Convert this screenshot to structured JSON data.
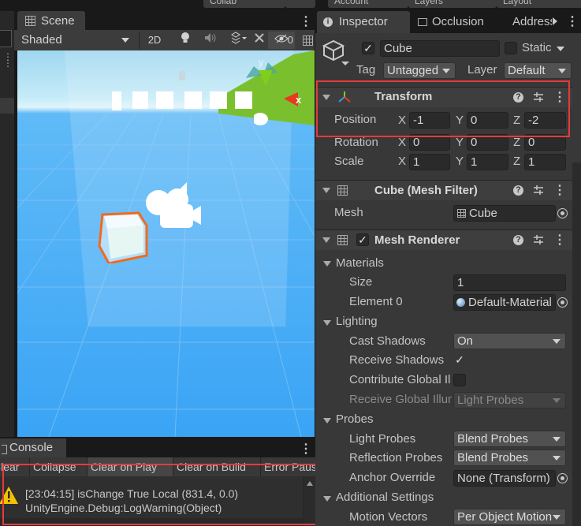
{
  "top": {
    "buttons": [
      "Collab",
      "Account",
      "Layers",
      "Layout"
    ]
  },
  "scene": {
    "tab_label": "Scene",
    "shading_mode": "Shaded",
    "toggle_2d": "2D",
    "gizmo_x_label": "x",
    "gizmo_y_label": "y",
    "hidden_count": "0"
  },
  "console": {
    "tab_label": "Console",
    "toolbar": [
      "Clear",
      "Collapse",
      "Clear on Play",
      "Clear on Build",
      "Error Pause"
    ],
    "log_line1": "[23:04:15] isChange   True   Local   (831.4, 0.0)",
    "log_line2": "UnityEngine.Debug:LogWarning(Object)"
  },
  "inspector": {
    "tabs": [
      "Inspector",
      "Occlusion",
      "Addressables"
    ],
    "object_name": "Cube",
    "static_label": "Static",
    "tag_label": "Tag",
    "tag_value": "Untagged",
    "layer_label": "Layer",
    "layer_value": "Default",
    "transform": {
      "title": "Transform",
      "position_label": "Position",
      "rotation_label": "Rotation",
      "scale_label": "Scale",
      "axes": [
        "X",
        "Y",
        "Z"
      ],
      "position": [
        "-1",
        "0",
        "-2"
      ],
      "rotation": [
        "0",
        "0",
        "0"
      ],
      "scale": [
        "1",
        "1",
        "1"
      ]
    },
    "mesh_filter": {
      "title": "Cube (Mesh Filter)",
      "mesh_label": "Mesh",
      "mesh_value": "Cube"
    },
    "mesh_renderer": {
      "title": "Mesh Renderer",
      "materials_label": "Materials",
      "size_label": "Size",
      "size_value": "1",
      "element0_label": "Element 0",
      "element0_value": "Default-Material",
      "lighting_label": "Lighting",
      "cast_shadows_label": "Cast Shadows",
      "cast_shadows_value": "On",
      "receive_shadows_label": "Receive Shadows",
      "contribute_gi_label": "Contribute Global Illumination",
      "receive_gi_label": "Receive Global Illumination",
      "receive_gi_value": "Light Probes",
      "probes_label": "Probes",
      "light_probes_label": "Light Probes",
      "light_probes_value": "Blend Probes",
      "reflection_probes_label": "Reflection Probes",
      "reflection_probes_value": "Blend Probes",
      "anchor_override_label": "Anchor Override",
      "anchor_override_value": "None (Transform)",
      "additional_settings_label": "Additional Settings",
      "motion_vectors_label": "Motion Vectors",
      "motion_vectors_value": "Per Object Motion"
    }
  },
  "colors": {
    "highlight_red": "#e53b3b",
    "gizmo_red": "#e8381f",
    "gizmo_green": "#7fcf1c",
    "selection_orange": "#f26a1b"
  }
}
